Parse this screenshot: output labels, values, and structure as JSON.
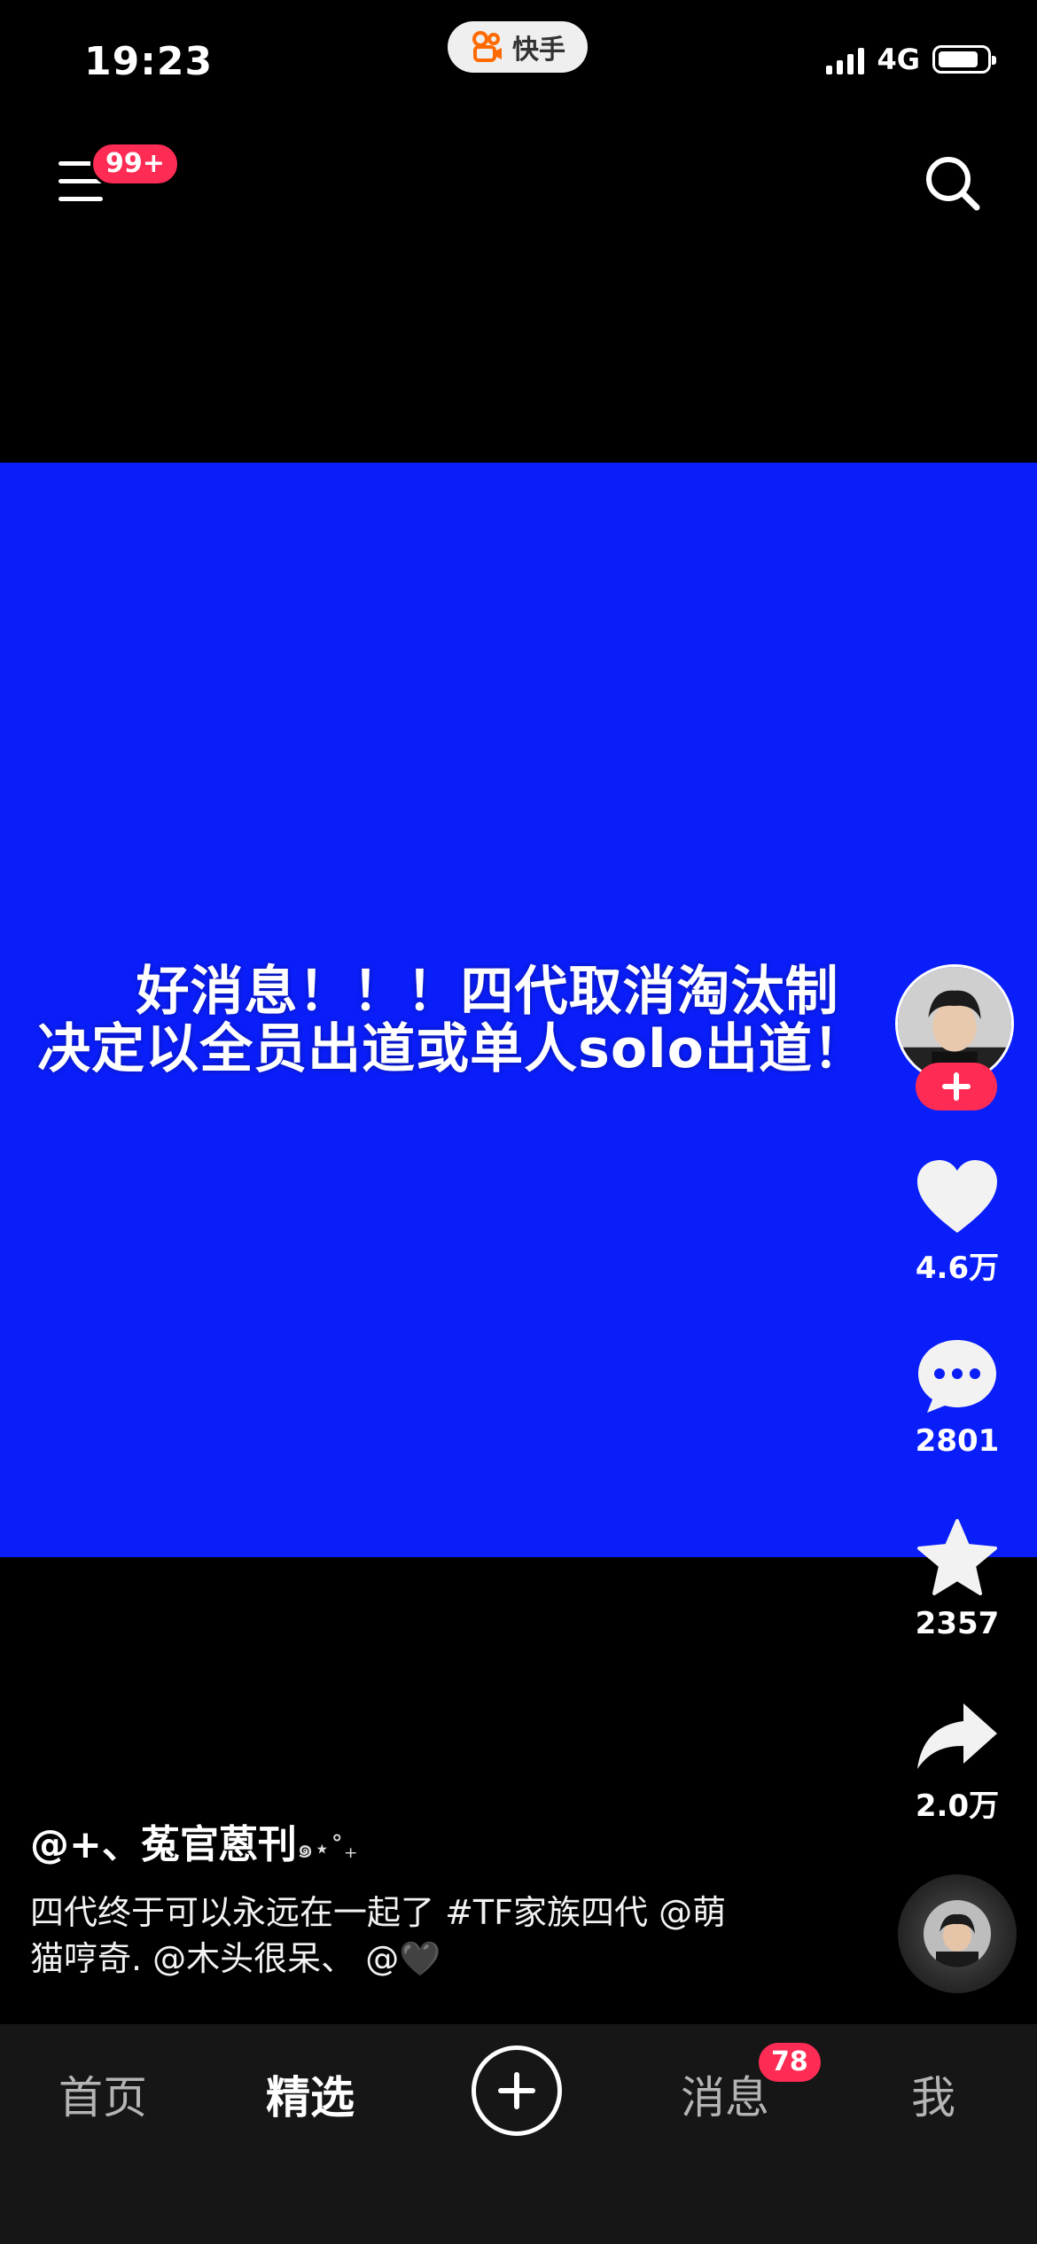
{
  "status_bar": {
    "time": "19:23",
    "network": "4G",
    "app_name": "快手",
    "app_logo_color": "#ff6a00"
  },
  "header": {
    "menu_badge": "99+",
    "menu_icon": "hamburger-menu-icon",
    "search_icon": "search-icon"
  },
  "video": {
    "background_color": "#0a1ef9",
    "overlay_line1": "好消息！！！四代取消淘汰制",
    "overlay_line2": "决定以全员出道或单人solo出道！"
  },
  "actions": {
    "follow_icon": "plus-icon",
    "likes": "4.6万",
    "comments": "2801",
    "favorites": "2357",
    "shares": "2.0万"
  },
  "post": {
    "author": "@+、菟官蒽刊",
    "author_decoration": "๑⋆˚₊",
    "caption_line1": "四代终于可以永远在一起了 #TF家族四代 @萌",
    "caption_line2": "猫哼奇. @木头很呆、 @🖤"
  },
  "tabbar": {
    "tabs": [
      {
        "label": "首页",
        "active": false
      },
      {
        "label": "精选",
        "active": true
      },
      {
        "label": "消息",
        "active": false
      },
      {
        "label": "我",
        "active": false
      }
    ],
    "messages_badge": "78"
  }
}
